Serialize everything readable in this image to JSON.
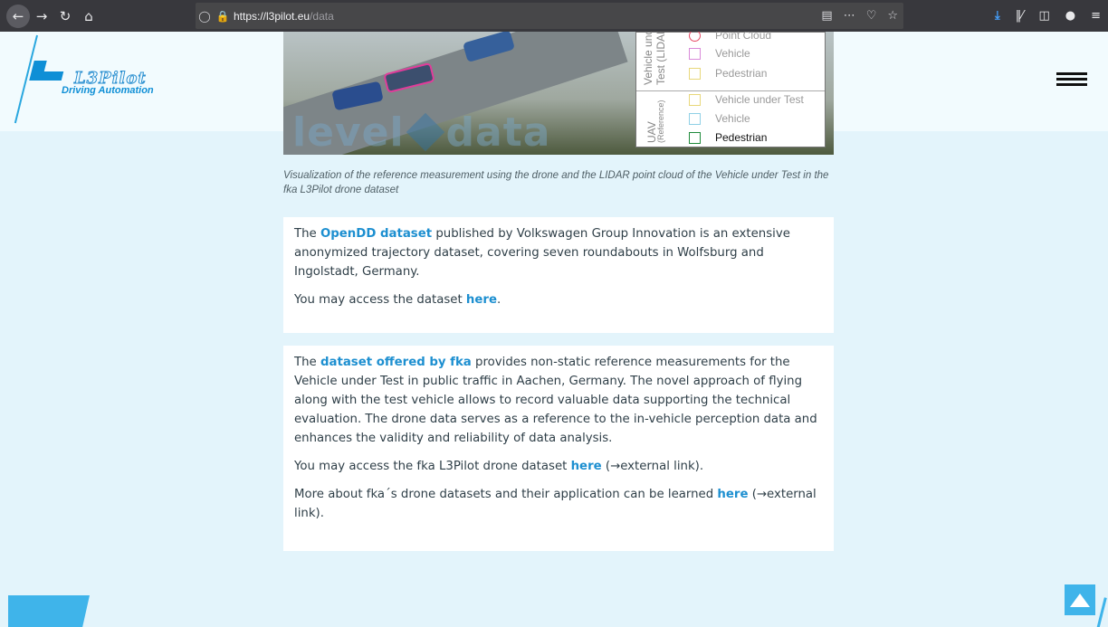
{
  "browser": {
    "url_host": "https://l3pilot.eu",
    "url_path": "/data",
    "back_icon": "arrow-left",
    "forward_icon": "arrow-right",
    "reload_icon": "reload",
    "home_icon": "home"
  },
  "header": {
    "logo_name": "L3Pilot",
    "logo_tagline": "Driving Automation"
  },
  "hero": {
    "watermark_left": "level",
    "watermark_right": "data",
    "legend": {
      "group1_label": "Vehicle under",
      "group1_sub": "Test (LIDAR)",
      "group1_items": [
        {
          "label": "Point Cloud",
          "color": "#e64a64"
        },
        {
          "label": "Vehicle",
          "color": "#d98ad9"
        },
        {
          "label": "Pedestrian",
          "color": "#e8d77a"
        }
      ],
      "group2_label": "UAV",
      "group2_sub": "(Reference)",
      "group2_items": [
        {
          "label": "Vehicle under Test",
          "color": "#e8d77a"
        },
        {
          "label": "Vehicle",
          "color": "#8fd0e6"
        },
        {
          "label": "Pedestrian",
          "color": "#1e8a3a"
        }
      ]
    }
  },
  "caption": "Visualization of the reference measurement using the drone and the LIDAR point cloud of the Vehicle under Test in the fka L3Pilot drone dataset",
  "card1": {
    "p1_pre": "The ",
    "p1_link": "OpenDD dataset",
    "p1_post": " published by Volkswagen Group Innovation is an extensive anonymized trajectory dataset, covering seven roundabouts in Wolfsburg and Ingolstadt, Germany.",
    "p2_pre": "You may access the dataset ",
    "p2_link": "here",
    "p2_post": "."
  },
  "card2": {
    "p1_pre": "The ",
    "p1_link": "dataset offered by fka",
    "p1_post": " provides non-static reference measurements for the Vehicle under Test in public traffic in Aachen, Germany. The novel approach of flying along with the test vehicle allows to record valuable data supporting the technical evaluation. The drone data serves as a reference to the in-vehicle perception data and enhances the validity and reliability of data analysis.",
    "p2_pre": "You may access the fka L3Pilot drone dataset ",
    "p2_link": "here",
    "p2_post": " (→external link).",
    "p3_pre": "More about fka´s drone datasets and their application can be learned ",
    "p3_link": "here",
    "p3_post": " (→external link)."
  },
  "colors": {
    "accent": "#1d8fd0",
    "background": "#e3f4fb",
    "deco": "#3fb4ea"
  }
}
